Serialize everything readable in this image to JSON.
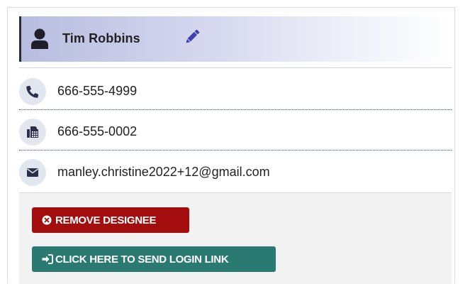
{
  "contact": {
    "name": "Tim Robbins",
    "phone": "666-555-4999",
    "fax": "666-555-0002",
    "email": "manley.christine2022+12@gmail.com"
  },
  "actions": {
    "remove_label": "REMOVE DESIGNEE",
    "login_link_label": "CLICK HERE TO SEND LOGIN LINK"
  },
  "icons": {
    "user": "user-icon",
    "edit": "pencil-icon",
    "phone": "phone-icon",
    "fax": "fax-icon",
    "email": "envelope-icon",
    "remove": "times-circle-icon",
    "login": "sign-in-icon"
  },
  "colors": {
    "header_gradient_start": "#b8bde0",
    "edit_icon": "#3f3fb0",
    "icon_circle": "#e2e6ef",
    "icon_glyph": "#2c2f4a",
    "remove_button": "#a30d0d",
    "login_button": "#2a7a72",
    "footer_background": "#f2f2f2"
  }
}
